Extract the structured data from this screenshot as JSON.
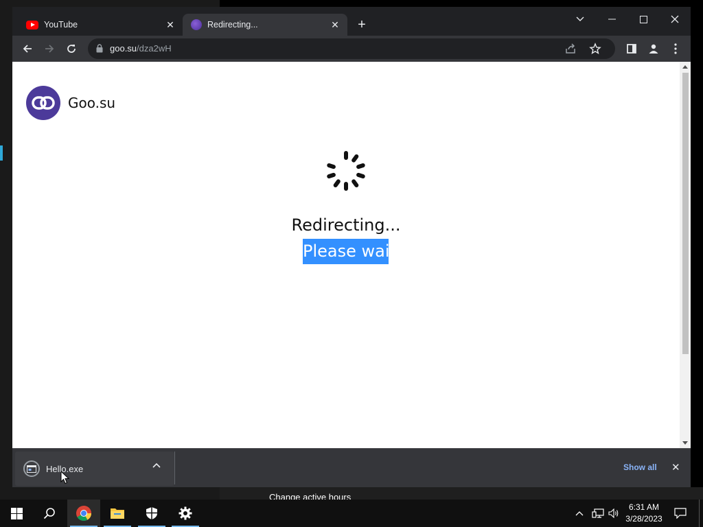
{
  "background": {
    "settings_text": "Change active hours"
  },
  "tabs": [
    {
      "title": "YouTube",
      "favicon": "youtube-icon",
      "active": false
    },
    {
      "title": "Redirecting...",
      "favicon": "goo-su-icon",
      "active": true
    }
  ],
  "address_bar": {
    "host": "goo.su",
    "path": "/dza2wH"
  },
  "page": {
    "brand_name": "Goo.su",
    "status_title": "Redirecting...",
    "status_subtitle": "Please wait",
    "selection_color": "#3390ff",
    "logo_color": "#4c3a9a"
  },
  "download_bar": {
    "file_name": "Hello.exe",
    "show_all_label": "Show all"
  },
  "taskbar": {
    "time": "6:31 AM",
    "date": "3/28/2023",
    "apps": [
      "start-icon",
      "search-icon",
      "chrome-icon",
      "file-explorer-icon",
      "windows-security-icon",
      "settings-icon"
    ]
  },
  "colors": {
    "chrome_frame": "#202124",
    "chrome_toolbar": "#35363a",
    "link_blue": "#8ab4f8"
  }
}
